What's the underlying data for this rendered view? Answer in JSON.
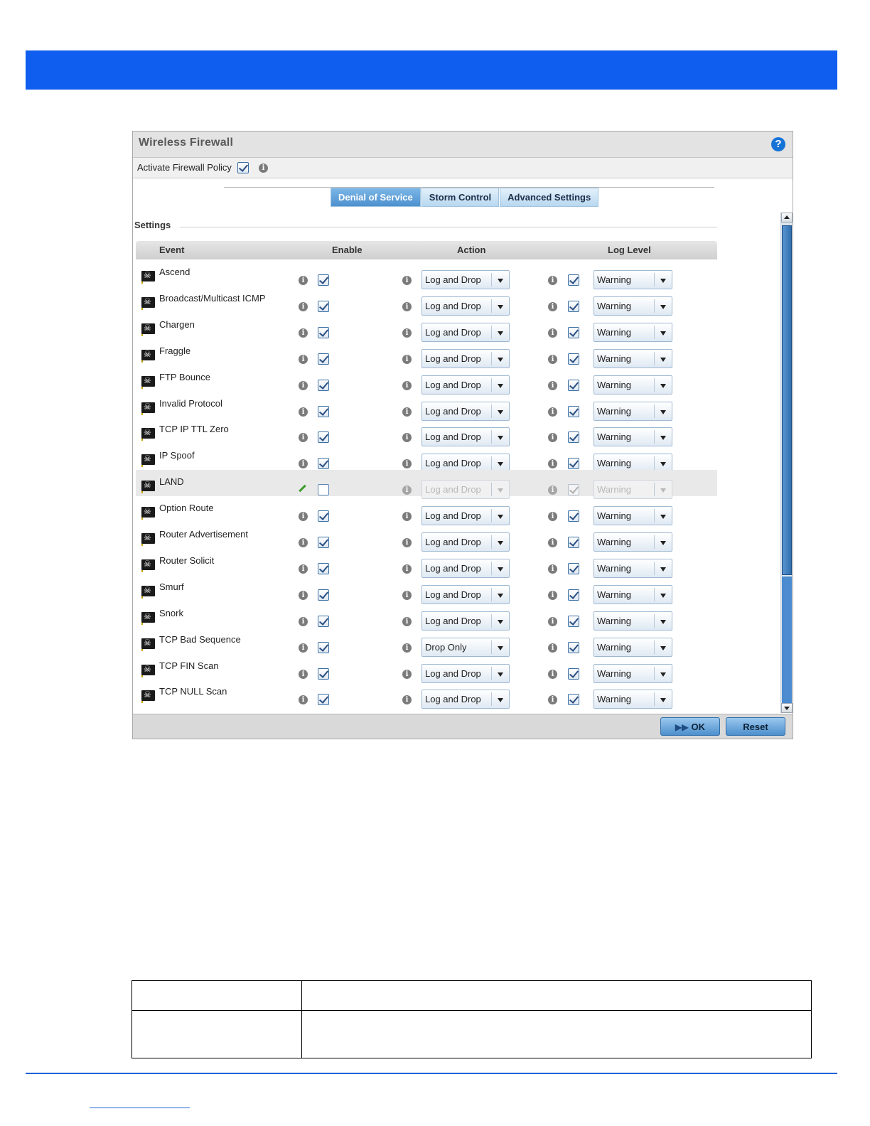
{
  "dialog": {
    "title": "Wireless Firewall",
    "help_icon": "help-icon",
    "activate_label": "Activate Firewall Policy",
    "activate_checked": true
  },
  "tabs": [
    {
      "label": "Denial of Service",
      "active": true
    },
    {
      "label": "Storm Control",
      "active": false
    },
    {
      "label": "Advanced Settings",
      "active": false
    }
  ],
  "settings_label": "Settings",
  "columns": {
    "event": "Event",
    "enable": "Enable",
    "action": "Action",
    "log_level": "Log Level"
  },
  "events": [
    {
      "name": "Ascend",
      "enabled": true,
      "action": "Log and Drop",
      "log": true,
      "level": "Warning"
    },
    {
      "name": "Broadcast/Multicast ICMP",
      "enabled": true,
      "action": "Log and Drop",
      "log": true,
      "level": "Warning"
    },
    {
      "name": "Chargen",
      "enabled": true,
      "action": "Log and Drop",
      "log": true,
      "level": "Warning"
    },
    {
      "name": "Fraggle",
      "enabled": true,
      "action": "Log and Drop",
      "log": true,
      "level": "Warning"
    },
    {
      "name": "FTP Bounce",
      "enabled": true,
      "action": "Log and Drop",
      "log": true,
      "level": "Warning"
    },
    {
      "name": "Invalid Protocol",
      "enabled": true,
      "action": "Log and Drop",
      "log": true,
      "level": "Warning"
    },
    {
      "name": "TCP IP TTL Zero",
      "enabled": true,
      "action": "Log and Drop",
      "log": true,
      "level": "Warning"
    },
    {
      "name": "IP Spoof",
      "enabled": true,
      "action": "Log and Drop",
      "log": true,
      "level": "Warning"
    },
    {
      "name": "LAND",
      "enabled": false,
      "action": "Log and Drop",
      "log": true,
      "level": "Warning",
      "editing": true
    },
    {
      "name": "Option Route",
      "enabled": true,
      "action": "Log and Drop",
      "log": true,
      "level": "Warning"
    },
    {
      "name": "Router Advertisement",
      "enabled": true,
      "action": "Log and Drop",
      "log": true,
      "level": "Warning"
    },
    {
      "name": "Router Solicit",
      "enabled": true,
      "action": "Log and Drop",
      "log": true,
      "level": "Warning"
    },
    {
      "name": "Smurf",
      "enabled": true,
      "action": "Log and Drop",
      "log": true,
      "level": "Warning"
    },
    {
      "name": "Snork",
      "enabled": true,
      "action": "Log and Drop",
      "log": true,
      "level": "Warning"
    },
    {
      "name": "TCP Bad Sequence",
      "enabled": true,
      "action": "Drop Only",
      "log": true,
      "level": "Warning"
    },
    {
      "name": "TCP FIN Scan",
      "enabled": true,
      "action": "Log and Drop",
      "log": true,
      "level": "Warning"
    },
    {
      "name": "TCP NULL Scan",
      "enabled": true,
      "action": "Log and Drop",
      "log": true,
      "level": "Warning"
    }
  ],
  "buttons": {
    "ok": "OK",
    "reset": "Reset"
  },
  "colors": {
    "banner": "#0f5ef0",
    "active_tab": "#4d91cf",
    "rule": "#1e63d6"
  }
}
